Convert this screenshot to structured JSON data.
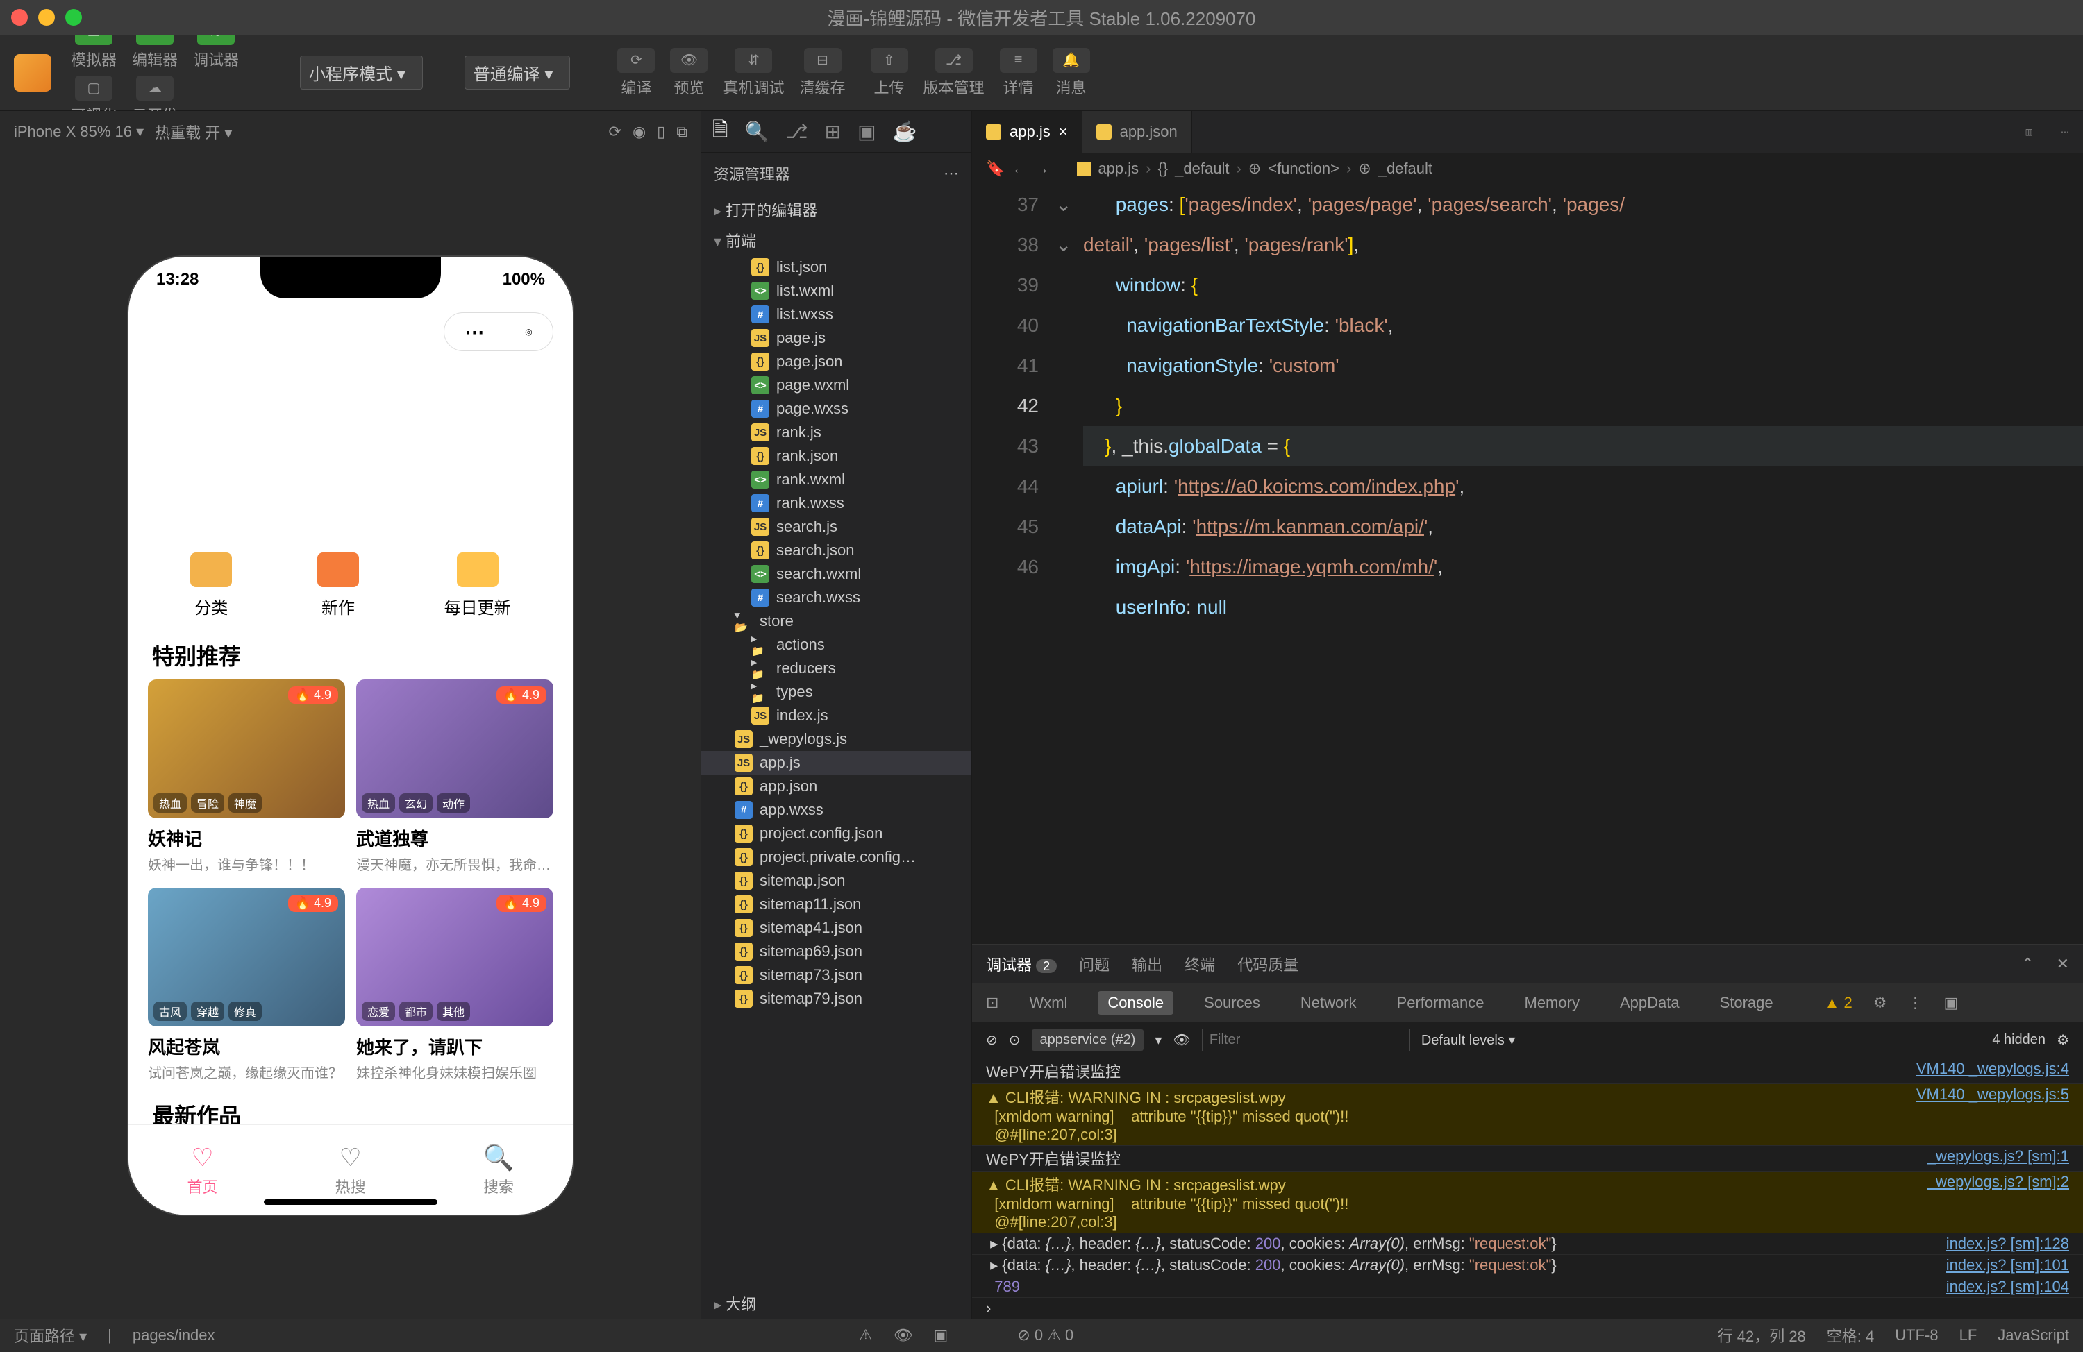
{
  "title": "漫画-锦鲤源码 - 微信开发者工具 Stable 1.06.2209070",
  "toolbar": {
    "groups": [
      {
        "style": "green",
        "items": [
          {
            "ico": "▭",
            "label": "模拟器"
          },
          {
            "ico": "</>",
            "label": "编辑器"
          },
          {
            "ico": "≋",
            "label": "调试器"
          }
        ]
      },
      {
        "style": "grey",
        "items": [
          {
            "ico": "▢",
            "label": "可视化"
          },
          {
            "ico": "☁",
            "label": "云开发"
          }
        ]
      }
    ],
    "mode": "小程序模式",
    "compile": "普通编译",
    "center": [
      {
        "ico": "⟳",
        "label": "编译"
      },
      {
        "ico": "👁",
        "label": "预览"
      },
      {
        "ico": "⇵",
        "label": "真机调试"
      },
      {
        "ico": "⊟",
        "label": "清缓存"
      }
    ],
    "right": [
      {
        "ico": "⇧",
        "label": "上传"
      },
      {
        "ico": "⎇",
        "label": "版本管理"
      },
      {
        "ico": "≡",
        "label": "详情"
      },
      {
        "ico": "🔔",
        "label": "消息"
      }
    ]
  },
  "simbar": {
    "device": "iPhone X 85% 16 ▾",
    "hot": "热重载 开 ▾"
  },
  "phone": {
    "time": "13:28",
    "battery": "100%",
    "nav": [
      {
        "ico": "#f3b24b",
        "label": "分类"
      },
      {
        "ico": "#f57c3a",
        "label": "新作"
      },
      {
        "ico": "#ffc34d",
        "label": "每日更新"
      }
    ],
    "section1": "特别推荐",
    "cards1": [
      {
        "bg": "linear-gradient(135deg,#d4a13a,#8a5a2a)",
        "badge": "🔥 4.9",
        "tags": [
          "热血",
          "冒险",
          "神魔"
        ],
        "title": "妖神记",
        "sub": "妖神一出，谁与争锋！！！"
      },
      {
        "bg": "linear-gradient(135deg,#9d7bc9,#5e4b8a)",
        "badge": "🔥 4.9",
        "tags": [
          "热血",
          "玄幻",
          "动作"
        ],
        "title": "武道独尊",
        "sub": "漫天神魔，亦无所畏惧，我命…"
      }
    ],
    "cards2": [
      {
        "bg": "linear-gradient(135deg,#6ba5c7,#3e5f7a)",
        "badge": "🔥 4.9",
        "tags": [
          "古风",
          "穿越",
          "修真"
        ],
        "title": "风起苍岚",
        "sub": "试问苍岚之巅，缘起缘灭而谁？"
      },
      {
        "bg": "linear-gradient(135deg,#b08bd9,#6a4d9d)",
        "badge": "🔥 4.9",
        "tags": [
          "恋爱",
          "都市",
          "其他"
        ],
        "title": "她来了，请趴下",
        "sub": "妹控杀神化身妹妹模扫娱乐圈"
      }
    ],
    "section2": "最新作品",
    "tabs": [
      {
        "ico": "♡",
        "label": "首页",
        "active": true
      },
      {
        "ico": "♡",
        "label": "热搜"
      },
      {
        "ico": "🔍",
        "label": "搜索"
      }
    ]
  },
  "explorer": {
    "hdr": "资源管理器",
    "sections": [
      "打开的编辑器",
      "前端"
    ],
    "files": [
      {
        "type": "json",
        "name": "list.json",
        "depth": 0
      },
      {
        "type": "wxml",
        "name": "list.wxml",
        "depth": 0
      },
      {
        "type": "wxss",
        "name": "list.wxss",
        "depth": 0
      },
      {
        "type": "js",
        "name": "page.js",
        "depth": 0
      },
      {
        "type": "json",
        "name": "page.json",
        "depth": 0
      },
      {
        "type": "wxml",
        "name": "page.wxml",
        "depth": 0
      },
      {
        "type": "wxss",
        "name": "page.wxss",
        "depth": 0
      },
      {
        "type": "js",
        "name": "rank.js",
        "depth": 0
      },
      {
        "type": "json",
        "name": "rank.json",
        "depth": 0
      },
      {
        "type": "wxml",
        "name": "rank.wxml",
        "depth": 0
      },
      {
        "type": "wxss",
        "name": "rank.wxss",
        "depth": 0
      },
      {
        "type": "js",
        "name": "search.js",
        "depth": 0
      },
      {
        "type": "json",
        "name": "search.json",
        "depth": 0
      },
      {
        "type": "wxml",
        "name": "search.wxml",
        "depth": 0
      },
      {
        "type": "wxss",
        "name": "search.wxss",
        "depth": 0
      },
      {
        "type": "folder",
        "name": "store",
        "open": true,
        "depth": -1
      },
      {
        "type": "folder",
        "name": "actions",
        "depth": 0
      },
      {
        "type": "folder",
        "name": "reducers",
        "depth": 0
      },
      {
        "type": "folder",
        "name": "types",
        "depth": 0
      },
      {
        "type": "js",
        "name": "index.js",
        "depth": 0
      },
      {
        "type": "js",
        "name": "_wepylogs.js",
        "depth": -1
      },
      {
        "type": "js",
        "name": "app.js",
        "depth": -1,
        "active": true
      },
      {
        "type": "json",
        "name": "app.json",
        "depth": -1
      },
      {
        "type": "wxss",
        "name": "app.wxss",
        "depth": -1
      },
      {
        "type": "json",
        "name": "project.config.json",
        "depth": -1
      },
      {
        "type": "json",
        "name": "project.private.config…",
        "depth": -1
      },
      {
        "type": "json",
        "name": "sitemap.json",
        "depth": -1
      },
      {
        "type": "json",
        "name": "sitemap11.json",
        "depth": -1
      },
      {
        "type": "json",
        "name": "sitemap41.json",
        "depth": -1
      },
      {
        "type": "json",
        "name": "sitemap69.json",
        "depth": -1
      },
      {
        "type": "json",
        "name": "sitemap73.json",
        "depth": -1
      },
      {
        "type": "json",
        "name": "sitemap79.json",
        "depth": -1
      }
    ],
    "outline": "大纲"
  },
  "tabs": [
    {
      "type": "js",
      "name": "app.js",
      "active": true,
      "close": "×"
    },
    {
      "type": "json",
      "name": "app.json",
      "active": false
    }
  ],
  "breadcrumb": [
    "app.js",
    "_default",
    "<function>",
    "_default"
  ],
  "code": {
    "lines": [
      {
        "n": 37,
        "html": "      <span class='key'>pages</span><span class='op'>:</span> <span class='br'>[</span><span class='str'>'pages/index'</span><span class='op'>,</span> <span class='str'>'pages/page'</span><span class='op'>,</span> <span class='str'>'pages/search'</span><span class='op'>,</span> <span class='str'>'pages/</span>"
      },
      {
        "n": "",
        "html": "<span class='str'>detail'</span><span class='op'>,</span> <span class='str'>'pages/list'</span><span class='op'>,</span> <span class='str'>'pages/rank'</span><span class='br'>]</span><span class='op'>,</span>"
      },
      {
        "n": 38,
        "fold": "⌄",
        "html": "      <span class='key'>window</span><span class='op'>:</span> <span class='br'>{</span>"
      },
      {
        "n": 39,
        "html": "        <span class='key'>navigationBarTextStyle</span><span class='op'>:</span> <span class='str'>'black'</span><span class='op'>,</span>"
      },
      {
        "n": 40,
        "html": "        <span class='key'>navigationStyle</span><span class='op'>:</span> <span class='str'>'custom'</span>"
      },
      {
        "n": 41,
        "html": "      <span class='br'>}</span>"
      },
      {
        "n": 42,
        "hl": true,
        "fold": "⌄",
        "html": "    <span class='br'>}</span><span class='op'>,</span> <span class='op'>_this.</span><span class='key'>globalData</span> <span class='op'>=</span> <span class='br'>{</span>"
      },
      {
        "n": 43,
        "html": "      <span class='key'>apiurl</span><span class='op'>:</span> <span class='str'>'</span><span class='link'>https://a0.koicms.com/index.php</span><span class='str'>'</span><span class='op'>,</span>"
      },
      {
        "n": 44,
        "html": "      <span class='key'>dataApi</span><span class='op'>:</span> <span class='str'>'</span><span class='link'>https://m.kanman.com/api/</span><span class='str'>'</span><span class='op'>,</span>"
      },
      {
        "n": 45,
        "html": "      <span class='key'>imgApi</span><span class='op'>:</span> <span class='str'>'</span><span class='link'>https://image.yqmh.com/mh/</span><span class='str'>'</span><span class='op'>,</span>"
      },
      {
        "n": 46,
        "html": "      <span class='key'>userInfo</span><span class='op'>:</span> <span class='key'>null</span>"
      }
    ]
  },
  "debugger": {
    "topTabs": [
      "调试器",
      "问题",
      "输出",
      "终端",
      "代码质量"
    ],
    "badge": "2",
    "panels": [
      "Wxml",
      "Console",
      "Sources",
      "Network",
      "Performance",
      "Memory",
      "AppData",
      "Storage"
    ],
    "warnBadge": "▲ 2",
    "context": "appservice (#2)",
    "filterPh": "Filter",
    "levels": "Default levels ▾",
    "hidden": "4 hidden",
    "rows": [
      {
        "cls": "",
        "msg": "WePY开启错误监控",
        "src": "VM140 _wepylogs.js:4"
      },
      {
        "cls": "warn",
        "msg": "▲ CLI报错: WARNING IN : srcpageslist.wpy\n  [xmldom warning]    attribute \"{{tip}}\" missed quot(\")!!\n  @#[line:207,col:3]",
        "src": "VM140 _wepylogs.js:5"
      },
      {
        "cls": "",
        "msg": "WePY开启错误监控",
        "src": "_wepylogs.js? [sm]:1"
      },
      {
        "cls": "warn",
        "msg": "▲ CLI报错: WARNING IN : srcpageslist.wpy\n  [xmldom warning]    attribute \"{{tip}}\" missed quot(\")!!\n  @#[line:207,col:3]",
        "src": "_wepylogs.js? [sm]:2"
      },
      {
        "cls": "",
        "msg": " ▸ {data: {…}, header: {…}, statusCode: 200, cookies: Array(0), errMsg: \"request:ok\"}",
        "src": "index.js? [sm]:128",
        "obj": true
      },
      {
        "cls": "",
        "msg": " ▸ {data: {…}, header: {…}, statusCode: 200, cookies: Array(0), errMsg: \"request:ok\"}",
        "src": "index.js? [sm]:101",
        "obj": true
      },
      {
        "cls": "",
        "msg": "  789",
        "src": "index.js? [sm]:104",
        "num": true
      },
      {
        "cls": "",
        "msg": "›",
        "src": ""
      }
    ]
  },
  "status": {
    "l1": "页面路径 ▾",
    "l2": "pages/index",
    "errs": "⊘ 0 ⚠ 0",
    "pos": "行 42，列 28",
    "spaces": "空格: 4",
    "enc": "UTF-8",
    "eol": "LF",
    "lang": "JavaScript"
  }
}
